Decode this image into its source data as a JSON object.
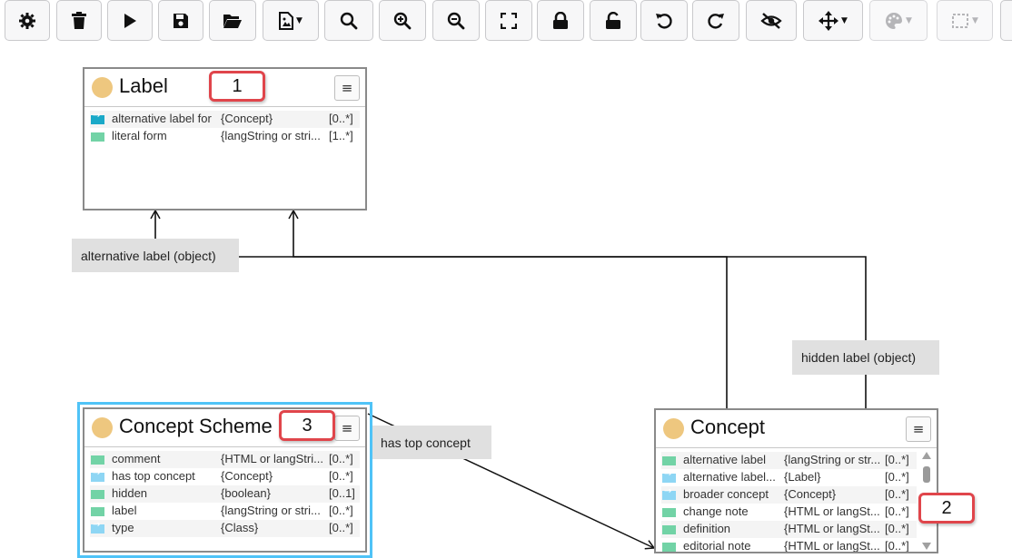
{
  "toolbar": {
    "buttons": [
      {
        "icon": "gear-icon"
      },
      {
        "icon": "trash-icon"
      },
      {
        "icon": "play-icon"
      },
      {
        "icon": "save-icon"
      },
      {
        "icon": "folder-open-icon"
      },
      {
        "icon": "export-image-icon"
      },
      {
        "icon": "search-icon"
      },
      {
        "icon": "zoom-in-icon"
      },
      {
        "icon": "zoom-out-icon"
      },
      {
        "icon": "fit-screen-icon"
      },
      {
        "icon": "lock-icon"
      },
      {
        "icon": "unlock-icon"
      },
      {
        "icon": "undo-icon"
      },
      {
        "icon": "redo-icon"
      },
      {
        "icon": "eye-off-icon"
      },
      {
        "icon": "move-icon"
      },
      {
        "icon": "palette-icon"
      },
      {
        "icon": "selection-box-icon"
      }
    ]
  },
  "nodes": {
    "label": {
      "title": "Label",
      "properties": [
        {
          "name": "alternative label for",
          "range": "{Concept}",
          "card": "[0..*]",
          "kind": "object-inverse"
        },
        {
          "name": "literal form",
          "range": "{langString or stri...",
          "card": "[1..*]",
          "kind": "data"
        }
      ]
    },
    "concept_scheme": {
      "title": "Concept Scheme",
      "properties": [
        {
          "name": "comment",
          "range": "{HTML or langStri...",
          "card": "[0..*]",
          "kind": "data"
        },
        {
          "name": "has top concept",
          "range": "{Concept}",
          "card": "[0..*]",
          "kind": "object"
        },
        {
          "name": "hidden",
          "range": "{boolean}",
          "card": "[0..1]",
          "kind": "data"
        },
        {
          "name": "label",
          "range": "{langString or stri...",
          "card": "[0..*]",
          "kind": "data"
        },
        {
          "name": "type",
          "range": "{Class}",
          "card": "[0..*]",
          "kind": "object"
        }
      ]
    },
    "concept": {
      "title": "Concept",
      "properties": [
        {
          "name": "alternative label",
          "range": "{langString or str...",
          "card": "[0..*]",
          "kind": "data"
        },
        {
          "name": "alternative label...",
          "range": "{Label}",
          "card": "[0..*]",
          "kind": "object"
        },
        {
          "name": "broader concept",
          "range": "{Concept}",
          "card": "[0..*]",
          "kind": "object"
        },
        {
          "name": "change note",
          "range": "{HTML or langSt...",
          "card": "[0..*]",
          "kind": "data"
        },
        {
          "name": "definition",
          "range": "{HTML or langSt...",
          "card": "[0..*]",
          "kind": "data"
        },
        {
          "name": "editorial note",
          "range": "{HTML or langSt...",
          "card": "[0..*]",
          "kind": "data"
        }
      ]
    }
  },
  "links": {
    "alt_label": "alternative label (object)",
    "hidden_label": "hidden label (object)",
    "top_concept": "has top concept"
  },
  "badges": {
    "b1": "1",
    "b2": "2",
    "b3": "3"
  },
  "menu_glyph": "≡"
}
